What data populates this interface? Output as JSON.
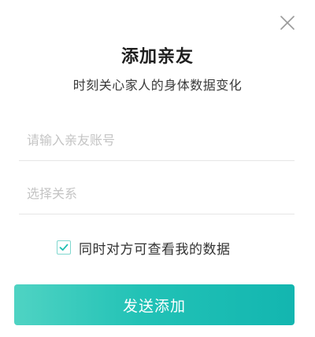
{
  "dialog": {
    "title": "添加亲友",
    "subtitle": "时刻关心家人的身体数据变化"
  },
  "form": {
    "account_placeholder": "请输入亲友账号",
    "relation_placeholder": "选择关系",
    "share_data_label": "同时对方可查看我的数据",
    "share_data_checked": true
  },
  "actions": {
    "close_icon": "close-icon",
    "submit_label": "发送添加"
  },
  "colors": {
    "accent": "#22c2b6",
    "check": "#1fbfb3"
  }
}
